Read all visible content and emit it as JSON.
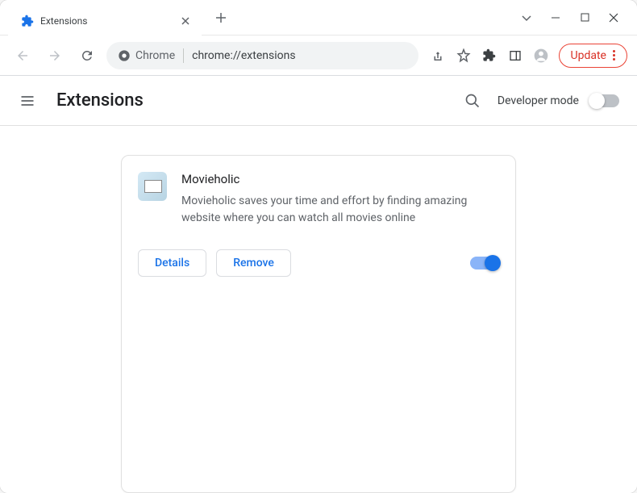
{
  "tab": {
    "title": "Extensions"
  },
  "omnibox": {
    "chip_label": "Chrome",
    "url": "chrome://extensions"
  },
  "toolbar": {
    "update_label": "Update"
  },
  "header": {
    "title": "Extensions",
    "devmode_label": "Developer mode"
  },
  "extension": {
    "name": "Movieholic",
    "description": "Movieholic saves your time and effort by finding amazing website where you can watch all movies online",
    "details_label": "Details",
    "remove_label": "Remove",
    "enabled": true
  }
}
